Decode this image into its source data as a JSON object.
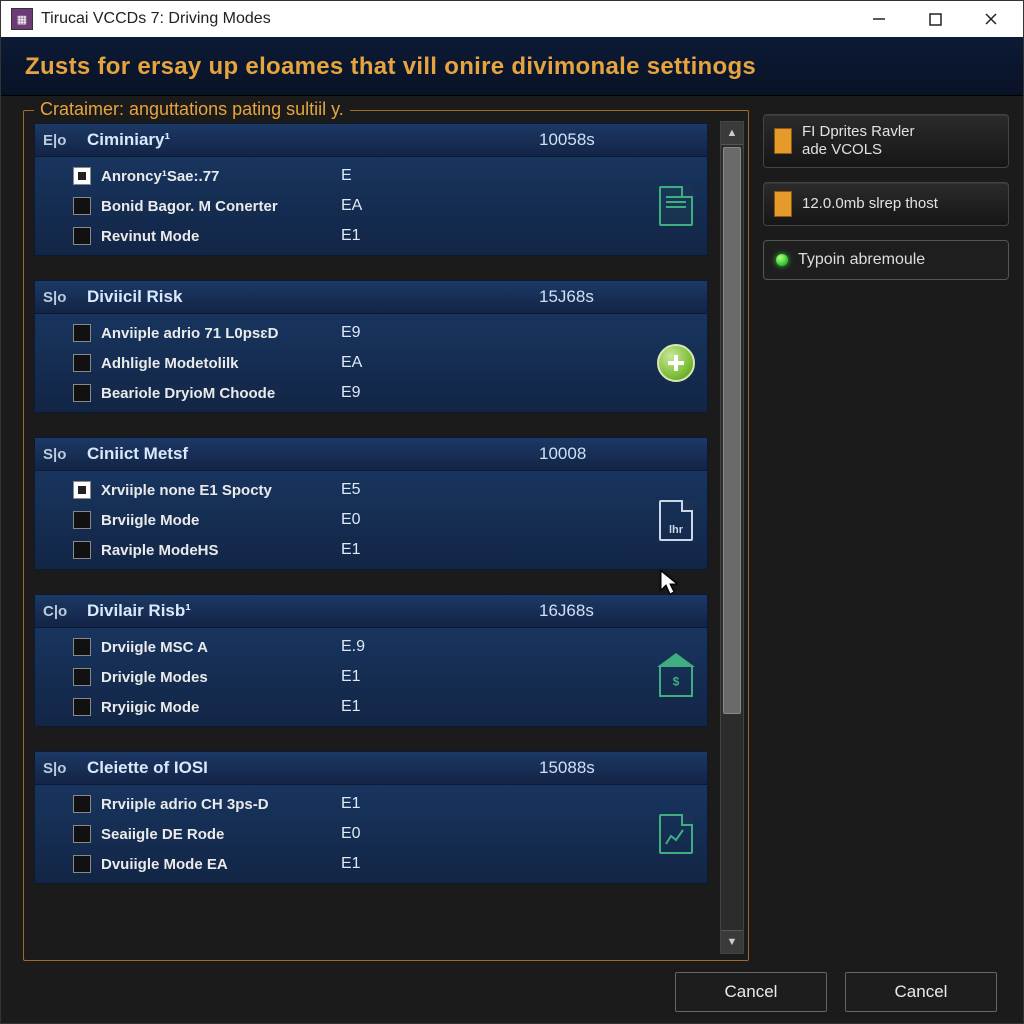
{
  "window": {
    "title": "Tirucai VCCDs 7: Driving Modes"
  },
  "banner": "Zusts for ersay up eloames that vill onire divimonale settinogs",
  "legend": "Crataimer: anguttations pating sultiil y.",
  "groups": [
    {
      "prefix": "E|o",
      "title": "Ciminiary¹",
      "code": "10058s",
      "icon": "doc",
      "rows": [
        {
          "checked": true,
          "label": "Anroncy¹Sae:.77",
          "value": "E"
        },
        {
          "checked": false,
          "label": "Bonid Bagor. M Conerter",
          "value": "EA"
        },
        {
          "checked": false,
          "label": "Revinut Mode",
          "value": "E1"
        }
      ]
    },
    {
      "prefix": "S|o",
      "title": "Diviicil Risk",
      "code": "15J68s",
      "icon": "plus",
      "rows": [
        {
          "checked": false,
          "label": "Anviiple adrio 71 L0psɛD",
          "value": "E9"
        },
        {
          "checked": false,
          "label": "Adhligle Modetolilk",
          "value": "EA"
        },
        {
          "checked": false,
          "label": "Beariole DryioM Choode",
          "value": "E9"
        }
      ]
    },
    {
      "prefix": "S|o",
      "title": "Ciniict Metsf",
      "code": "10008",
      "icon": "file",
      "icon_text": "lhr",
      "rows": [
        {
          "checked": true,
          "label": "Xrviiple none E1 Spocty",
          "value": "E5"
        },
        {
          "checked": false,
          "label": "Brviigle Mode",
          "value": "E0"
        },
        {
          "checked": false,
          "label": "Raviple ModeHS",
          "value": "E1"
        }
      ]
    },
    {
      "prefix": "C|o",
      "title": "Divilair Risb¹",
      "code": "16J68s",
      "icon": "home",
      "icon_text": "$",
      "rows": [
        {
          "checked": false,
          "label": "Drviigle MSC A",
          "value": "E.9"
        },
        {
          "checked": false,
          "label": "Drivigle Modes",
          "value": "E1"
        },
        {
          "checked": false,
          "label": "Rryiigic Mode",
          "value": "E1"
        }
      ]
    },
    {
      "prefix": "S|o",
      "title": "Cleiette of IOSI",
      "code": "15088s",
      "icon": "chart",
      "rows": [
        {
          "checked": false,
          "label": "Rrviiple adrio CH 3ps-D",
          "value": "E1"
        },
        {
          "checked": false,
          "label": "Seaiigle DE Rode",
          "value": "E0"
        },
        {
          "checked": false,
          "label": "Dvuiigle Mode EA",
          "value": "E1"
        }
      ]
    }
  ],
  "sidebar": {
    "btn1_line1": "FI Dprites Ravler",
    "btn1_line2": "ade VCOLS",
    "btn2": "12.0.0mb slrep thost",
    "status": "Typoin abremoule"
  },
  "footer": {
    "btn1": "Cancel",
    "btn2": "Cancel"
  }
}
